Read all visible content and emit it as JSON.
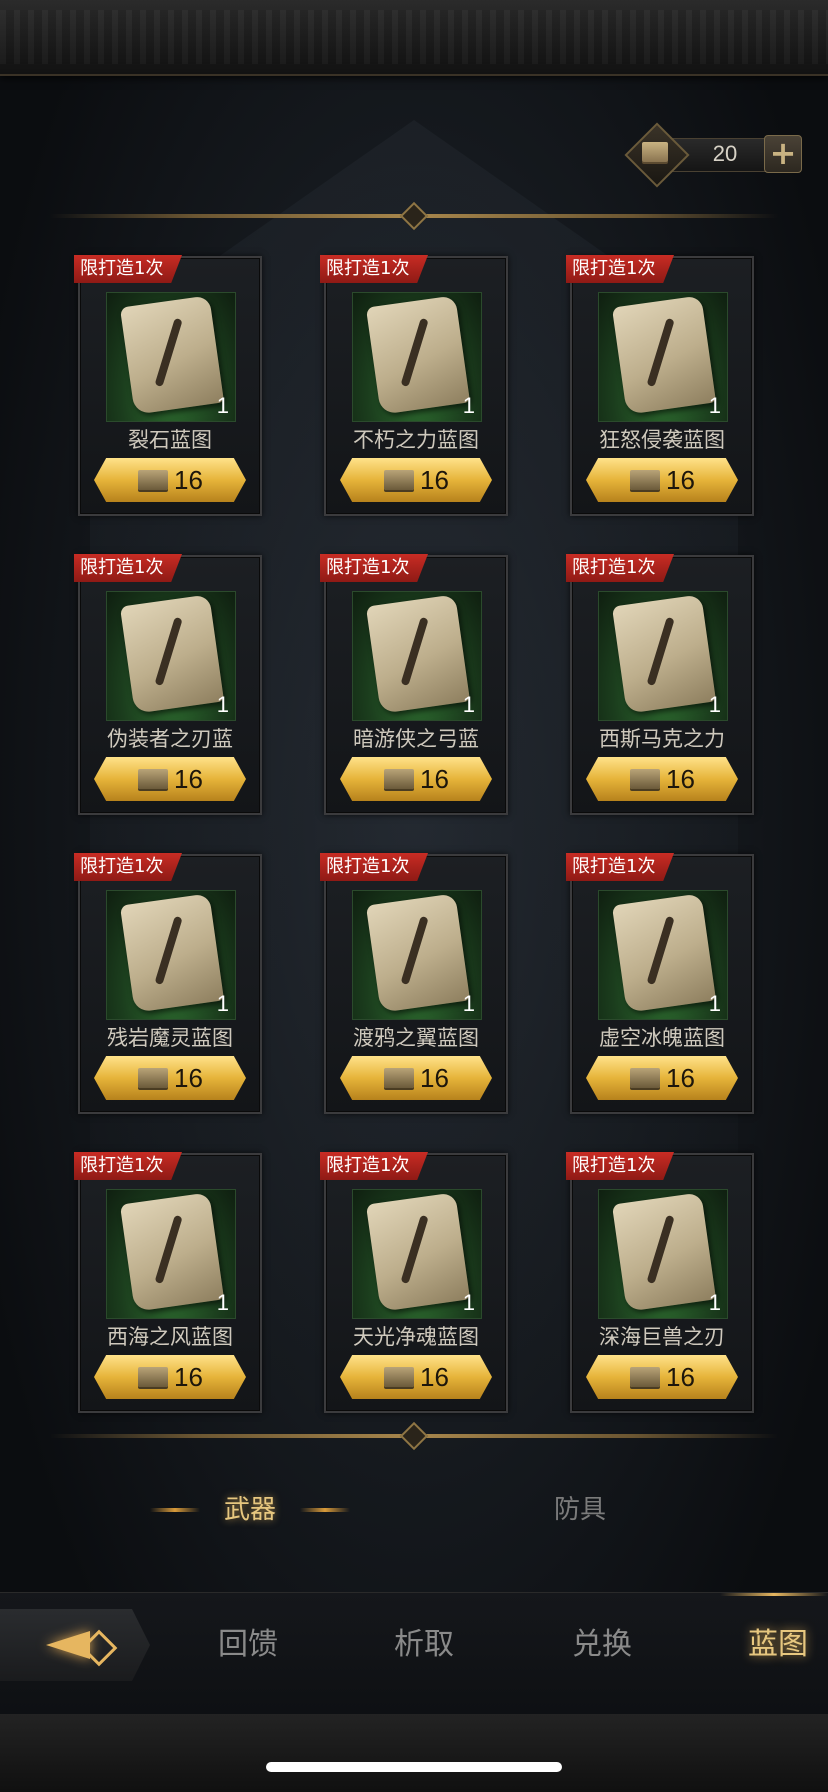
{
  "currency": {
    "icon": "blueprint-book-icon",
    "amount": "20",
    "add_icon": "plus-icon"
  },
  "cards": [
    {
      "tag": "限打造1次",
      "name": "裂石蓝图",
      "qty": "1",
      "price": "16"
    },
    {
      "tag": "限打造1次",
      "name": "不朽之力蓝图",
      "qty": "1",
      "price": "16"
    },
    {
      "tag": "限打造1次",
      "name": "狂怒侵袭蓝图",
      "qty": "1",
      "price": "16"
    },
    {
      "tag": "限打造1次",
      "name": "伪装者之刃蓝",
      "qty": "1",
      "price": "16"
    },
    {
      "tag": "限打造1次",
      "name": "暗游侠之弓蓝",
      "qty": "1",
      "price": "16"
    },
    {
      "tag": "限打造1次",
      "name": "西斯马克之力",
      "qty": "1",
      "price": "16"
    },
    {
      "tag": "限打造1次",
      "name": "残岩魔灵蓝图",
      "qty": "1",
      "price": "16"
    },
    {
      "tag": "限打造1次",
      "name": "渡鸦之翼蓝图",
      "qty": "1",
      "price": "16"
    },
    {
      "tag": "限打造1次",
      "name": "虚空冰魄蓝图",
      "qty": "1",
      "price": "16"
    },
    {
      "tag": "限打造1次",
      "name": "西海之风蓝图",
      "qty": "1",
      "price": "16"
    },
    {
      "tag": "限打造1次",
      "name": "天光净魂蓝图",
      "qty": "1",
      "price": "16"
    },
    {
      "tag": "限打造1次",
      "name": "深海巨兽之刃",
      "qty": "1",
      "price": "16"
    }
  ],
  "tabs": {
    "weapon": "武器",
    "armor": "防具",
    "active": "weapon"
  },
  "nav": {
    "items": [
      "回馈",
      "析取",
      "兑换",
      "蓝图"
    ],
    "active": "蓝图"
  },
  "colors": {
    "accent_gold": "#e7c77f",
    "tag_red": "#c82c24",
    "price_gold": "#e6b43a"
  }
}
